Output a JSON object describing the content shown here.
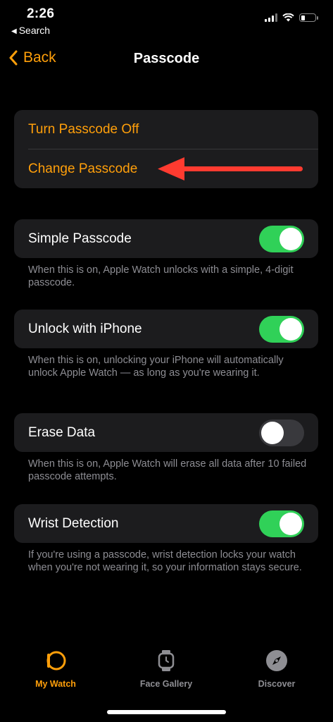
{
  "status_bar": {
    "time": "2:26",
    "back_app": "Search"
  },
  "nav": {
    "back_label": "Back",
    "title": "Passcode"
  },
  "passcode_actions": {
    "turn_off": "Turn Passcode Off",
    "change": "Change Passcode"
  },
  "settings": [
    {
      "label": "Simple Passcode",
      "on": true,
      "footnote": "When this is on, Apple Watch unlocks with a simple, 4-digit passcode."
    },
    {
      "label": "Unlock with iPhone",
      "on": true,
      "footnote": "When this is on, unlocking your iPhone will automatically unlock Apple Watch — as long as you're wearing it."
    },
    {
      "label": "Erase Data",
      "on": false,
      "footnote": "When this is on, Apple Watch will erase all data after 10 failed passcode attempts."
    },
    {
      "label": "Wrist Detection",
      "on": true,
      "footnote": "If you're using a passcode, wrist detection locks your watch when you're not wearing it, so your information stays secure."
    }
  ],
  "tabs": [
    {
      "label": "My Watch",
      "icon": "my-watch-icon",
      "active": true
    },
    {
      "label": "Face Gallery",
      "icon": "face-gallery-icon",
      "active": false
    },
    {
      "label": "Discover",
      "icon": "compass-icon",
      "active": false
    }
  ],
  "colors": {
    "accent": "#ff9f0a",
    "toggle_on": "#30d158",
    "arrow": "#ff3b30"
  }
}
